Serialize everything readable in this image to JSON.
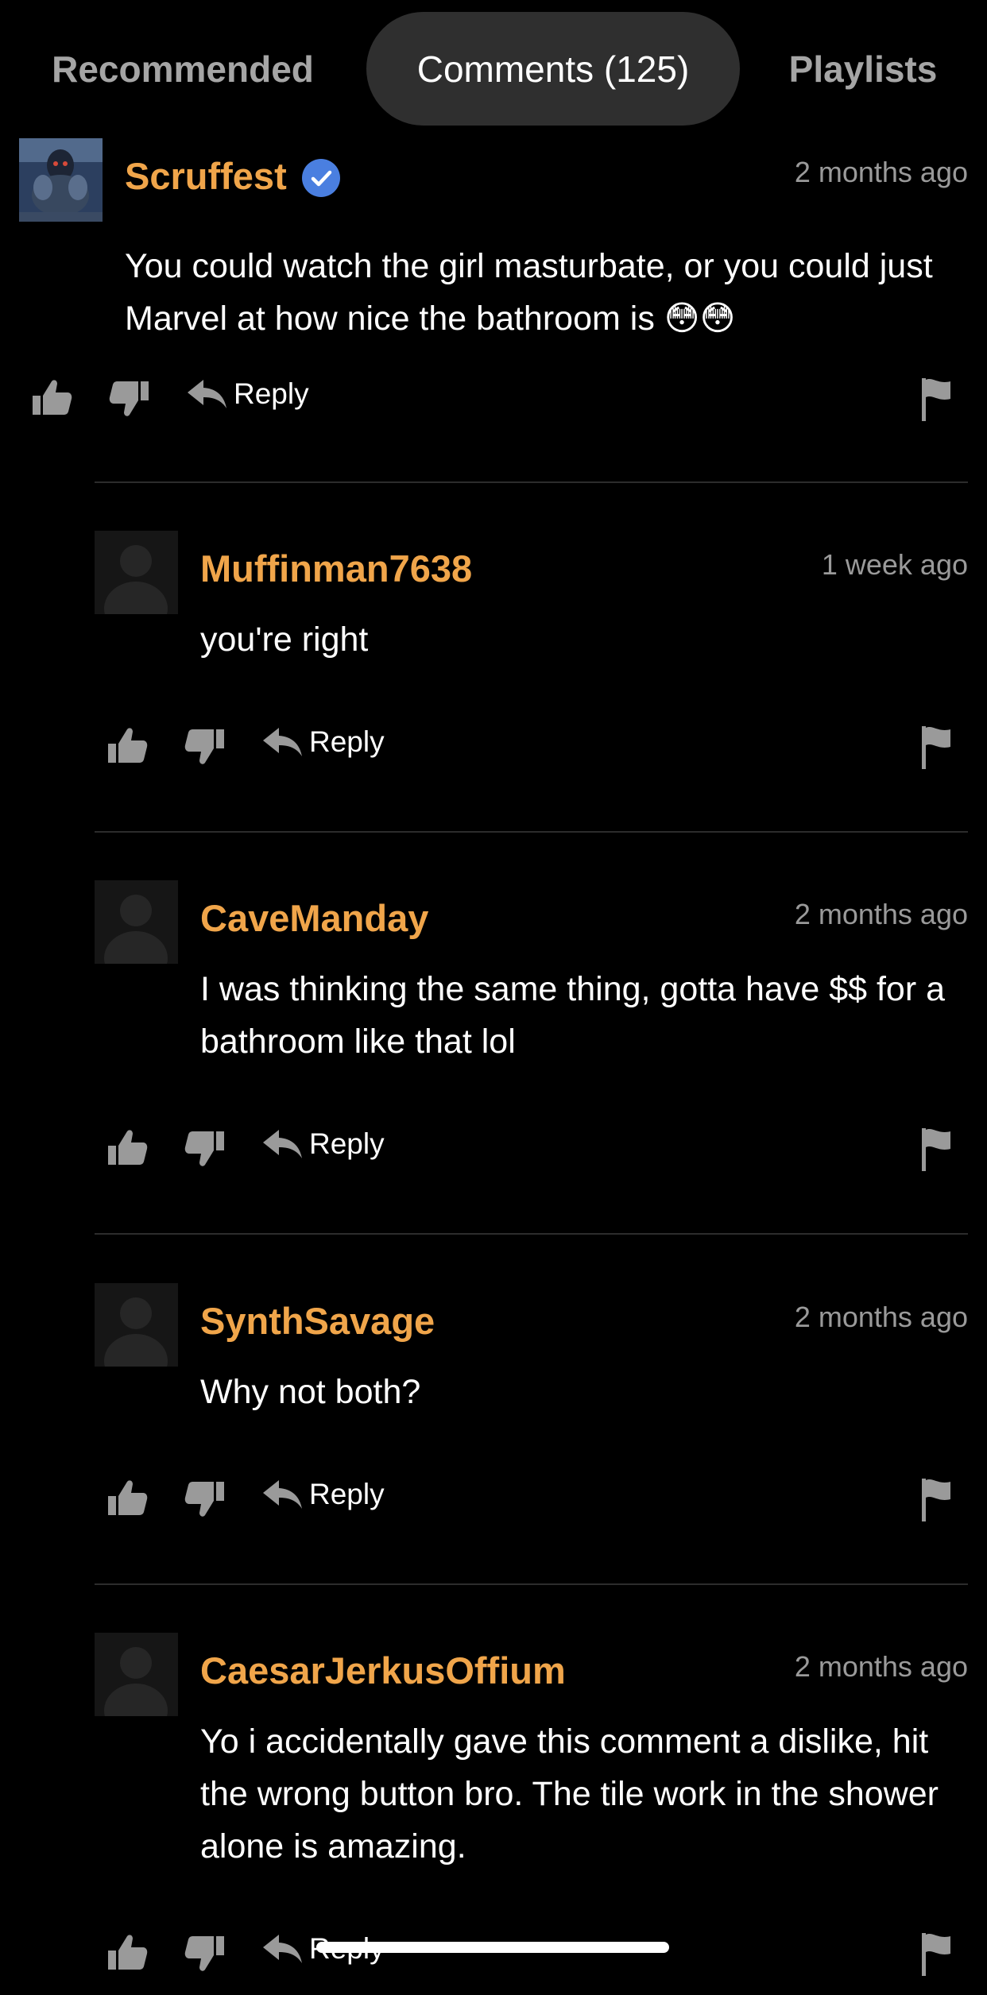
{
  "tabs": {
    "recommended": "Recommended",
    "comments": "Comments (125)",
    "playlists": "Playlists"
  },
  "actions": {
    "reply_label": "Reply"
  },
  "colors": {
    "username": "#f0a54a",
    "active_tab_bg": "#2f2f2f",
    "verified": "#4a7fe0",
    "icon": "#9a9a9a"
  },
  "comments": [
    {
      "username": "Scruffest",
      "verified": true,
      "avatar": "custom-avatar",
      "time": "2 months ago",
      "text": "You could watch the girl masturbate, or you could just Marvel at how nice the bathroom is 😳😳"
    },
    {
      "username": "Muffinman7638",
      "verified": false,
      "avatar": "default-avatar",
      "time": "1 week ago",
      "text": "you're right"
    },
    {
      "username": "CaveManday",
      "verified": false,
      "avatar": "default-avatar",
      "time": "2 months ago",
      "text": "I was thinking the same thing, gotta have $$ for a bathroom like that lol"
    },
    {
      "username": "SynthSavage",
      "verified": false,
      "avatar": "default-avatar",
      "time": "2 months ago",
      "text": "Why not both?"
    },
    {
      "username": "CaesarJerkusOffium",
      "verified": false,
      "avatar": "default-avatar",
      "time": "2 months ago",
      "text": "Yo i accidentally gave this comment a dislike, hit the wrong button bro. The tile work in the shower alone is amazing."
    }
  ]
}
